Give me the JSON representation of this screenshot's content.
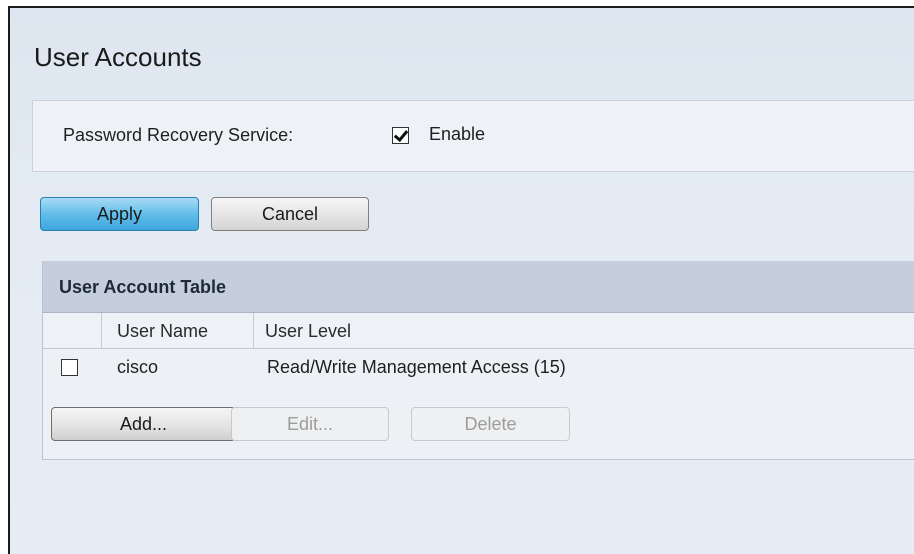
{
  "page": {
    "title": "User Accounts"
  },
  "password_recovery": {
    "label": "Password Recovery Service:",
    "enabled": true,
    "enable_label": "Enable"
  },
  "actions": {
    "apply_label": "Apply",
    "cancel_label": "Cancel"
  },
  "user_table": {
    "title": "User Account Table",
    "columns": [
      "User Name",
      "User Level"
    ],
    "rows": [
      {
        "checked": false,
        "user_name": "cisco",
        "user_level": "Read/Write Management Access (15)"
      }
    ],
    "add_label": "Add...",
    "edit_label": "Edit...",
    "delete_label": "Delete"
  },
  "colors": {
    "apply_button": "#5dbbe9",
    "table_header": "#c4cfdb",
    "disabled_text": "#9c9c9c"
  }
}
